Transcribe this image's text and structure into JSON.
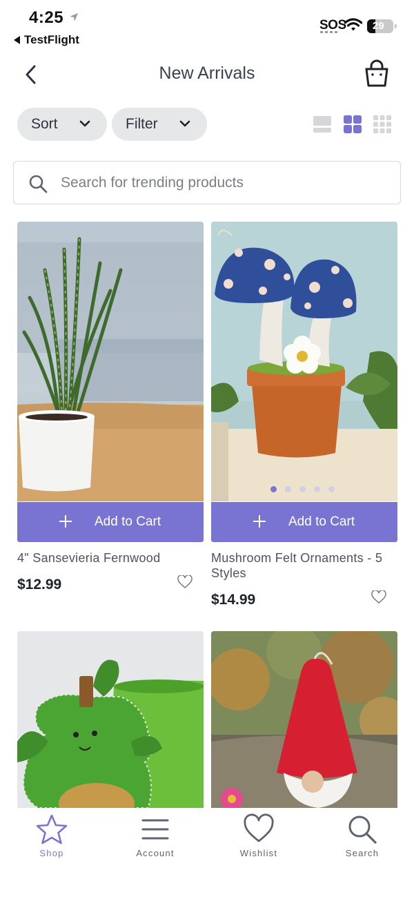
{
  "status_bar": {
    "time": "4:25",
    "back_app": "TestFlight",
    "sos": "SOS",
    "battery": "29"
  },
  "header": {
    "title": "New Arrivals"
  },
  "controls": {
    "sort_label": "Sort",
    "filter_label": "Filter",
    "active_view": "grid-2"
  },
  "search": {
    "placeholder": "Search for trending products",
    "value": ""
  },
  "products": [
    {
      "name": "4\" Sansevieria Fernwood",
      "price": "$12.99",
      "cta": "Add to Cart"
    },
    {
      "name": "Mushroom Felt Ornaments - 5 Styles",
      "price": "$14.99",
      "cta": "Add to Cart",
      "image_dots": 5,
      "active_dot": 1
    },
    {
      "name": "",
      "price": "",
      "cta": ""
    },
    {
      "name": "",
      "price": "",
      "cta": ""
    }
  ],
  "tabbar": {
    "items": [
      {
        "label": "Shop",
        "icon": "star-icon",
        "active": true
      },
      {
        "label": "Account",
        "icon": "menu-icon",
        "active": false
      },
      {
        "label": "Wishlist",
        "icon": "heart-icon",
        "active": false
      },
      {
        "label": "Search",
        "icon": "search-icon",
        "active": false
      }
    ]
  },
  "colors": {
    "accent": "#7974d1",
    "pill_bg": "#e6e7e9",
    "text": "#2d3440"
  }
}
